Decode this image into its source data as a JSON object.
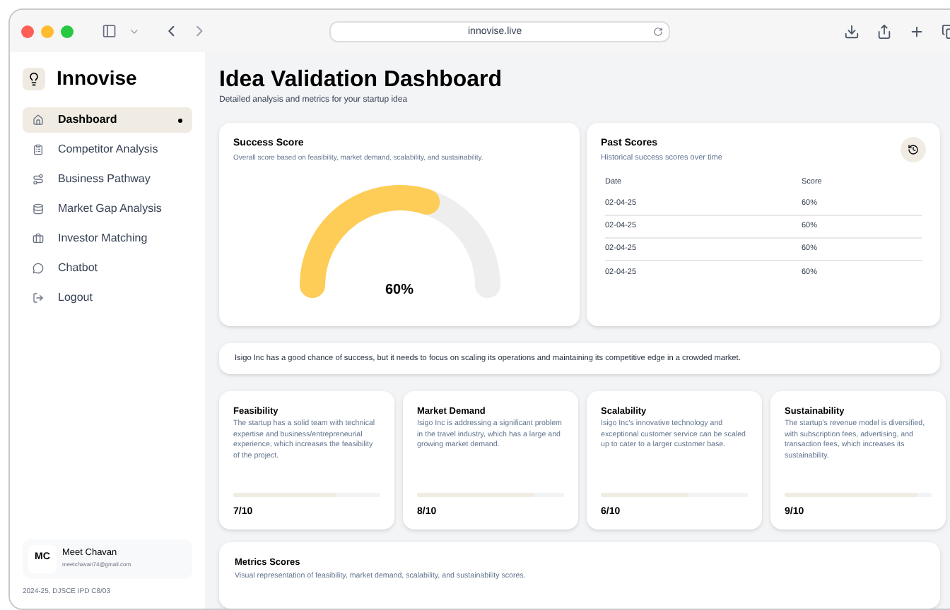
{
  "browser": {
    "url": "innovise.live"
  },
  "sidebar": {
    "brand": "Innovise",
    "items": [
      {
        "label": "Dashboard",
        "selected": true
      },
      {
        "label": "Competitor Analysis",
        "selected": false
      },
      {
        "label": "Business Pathway",
        "selected": false
      },
      {
        "label": "Market Gap Analysis",
        "selected": false
      },
      {
        "label": "Investor Matching",
        "selected": false
      },
      {
        "label": "Chatbot",
        "selected": false
      },
      {
        "label": "Logout",
        "selected": false
      }
    ],
    "user": {
      "initials": "MC",
      "name": "Meet Chavan",
      "email": "meetchavan74@gmail.com"
    },
    "footer": "2024-25, DJSCE IPD C8/03"
  },
  "header": {
    "title": "Idea Validation Dashboard",
    "subtitle": "Detailed analysis and metrics for your startup idea"
  },
  "success_score": {
    "title": "Success Score",
    "description": "Overall score based on feasibility, market demand, scalability, and sustainability.",
    "reading": "60%"
  },
  "past_scores": {
    "title": "Past Scores",
    "description": "Historical success scores over time",
    "columns": [
      "Date",
      "Score"
    ],
    "rows": [
      [
        "02-04-25",
        "60%"
      ],
      [
        "02-04-25",
        "60%"
      ],
      [
        "02-04-25",
        "60%"
      ],
      [
        "02-04-25",
        "60%"
      ]
    ]
  },
  "summary": "Isigo Inc has a good chance of success, but it needs to focus on scaling its operations and maintaining its competitive edge in a crowded market.",
  "metrics": [
    {
      "title": "Feasibility",
      "text": "The startup has a solid team with technical expertise and business/entrepreneurial experience, which increases the feasibility of the project.",
      "level": 0.7,
      "score": "7/10"
    },
    {
      "title": "Market Demand",
      "text": "Isigo Inc is addressing a significant problem in the travel industry, which has a large and growing market demand.",
      "level": 0.8,
      "score": "8/10"
    },
    {
      "title": "Scalability",
      "text": "Isigo Inc's innovative technology and exceptional customer service can be scaled up to cater to a larger customer base.",
      "level": 0.6,
      "score": "6/10"
    },
    {
      "title": "Sustainability",
      "text": "The startup's revenue model is diversified, with subscription fees, advertising, and transaction fees, which increases its sustainability.",
      "level": 0.9,
      "score": "9/10"
    }
  ],
  "metrics_scores": {
    "title": "Metrics Scores",
    "description": "Visual representation of feasibility, market demand, scalability, and sustainability scores."
  }
}
